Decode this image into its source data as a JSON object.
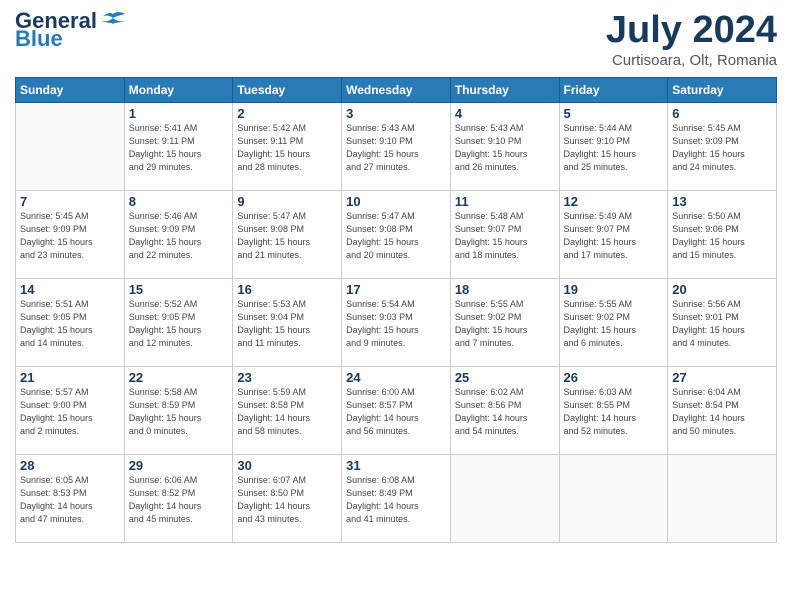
{
  "header": {
    "logo_line1": "General",
    "logo_line2": "Blue",
    "month": "July 2024",
    "location": "Curtisoara, Olt, Romania"
  },
  "days_of_week": [
    "Sunday",
    "Monday",
    "Tuesday",
    "Wednesday",
    "Thursday",
    "Friday",
    "Saturday"
  ],
  "weeks": [
    [
      {
        "day": "",
        "info": ""
      },
      {
        "day": "1",
        "info": "Sunrise: 5:41 AM\nSunset: 9:11 PM\nDaylight: 15 hours\nand 29 minutes."
      },
      {
        "day": "2",
        "info": "Sunrise: 5:42 AM\nSunset: 9:11 PM\nDaylight: 15 hours\nand 28 minutes."
      },
      {
        "day": "3",
        "info": "Sunrise: 5:43 AM\nSunset: 9:10 PM\nDaylight: 15 hours\nand 27 minutes."
      },
      {
        "day": "4",
        "info": "Sunrise: 5:43 AM\nSunset: 9:10 PM\nDaylight: 15 hours\nand 26 minutes."
      },
      {
        "day": "5",
        "info": "Sunrise: 5:44 AM\nSunset: 9:10 PM\nDaylight: 15 hours\nand 25 minutes."
      },
      {
        "day": "6",
        "info": "Sunrise: 5:45 AM\nSunset: 9:09 PM\nDaylight: 15 hours\nand 24 minutes."
      }
    ],
    [
      {
        "day": "7",
        "info": "Sunrise: 5:45 AM\nSunset: 9:09 PM\nDaylight: 15 hours\nand 23 minutes."
      },
      {
        "day": "8",
        "info": "Sunrise: 5:46 AM\nSunset: 9:09 PM\nDaylight: 15 hours\nand 22 minutes."
      },
      {
        "day": "9",
        "info": "Sunrise: 5:47 AM\nSunset: 9:08 PM\nDaylight: 15 hours\nand 21 minutes."
      },
      {
        "day": "10",
        "info": "Sunrise: 5:47 AM\nSunset: 9:08 PM\nDaylight: 15 hours\nand 20 minutes."
      },
      {
        "day": "11",
        "info": "Sunrise: 5:48 AM\nSunset: 9:07 PM\nDaylight: 15 hours\nand 18 minutes."
      },
      {
        "day": "12",
        "info": "Sunrise: 5:49 AM\nSunset: 9:07 PM\nDaylight: 15 hours\nand 17 minutes."
      },
      {
        "day": "13",
        "info": "Sunrise: 5:50 AM\nSunset: 9:06 PM\nDaylight: 15 hours\nand 15 minutes."
      }
    ],
    [
      {
        "day": "14",
        "info": "Sunrise: 5:51 AM\nSunset: 9:05 PM\nDaylight: 15 hours\nand 14 minutes."
      },
      {
        "day": "15",
        "info": "Sunrise: 5:52 AM\nSunset: 9:05 PM\nDaylight: 15 hours\nand 12 minutes."
      },
      {
        "day": "16",
        "info": "Sunrise: 5:53 AM\nSunset: 9:04 PM\nDaylight: 15 hours\nand 11 minutes."
      },
      {
        "day": "17",
        "info": "Sunrise: 5:54 AM\nSunset: 9:03 PM\nDaylight: 15 hours\nand 9 minutes."
      },
      {
        "day": "18",
        "info": "Sunrise: 5:55 AM\nSunset: 9:02 PM\nDaylight: 15 hours\nand 7 minutes."
      },
      {
        "day": "19",
        "info": "Sunrise: 5:55 AM\nSunset: 9:02 PM\nDaylight: 15 hours\nand 6 minutes."
      },
      {
        "day": "20",
        "info": "Sunrise: 5:56 AM\nSunset: 9:01 PM\nDaylight: 15 hours\nand 4 minutes."
      }
    ],
    [
      {
        "day": "21",
        "info": "Sunrise: 5:57 AM\nSunset: 9:00 PM\nDaylight: 15 hours\nand 2 minutes."
      },
      {
        "day": "22",
        "info": "Sunrise: 5:58 AM\nSunset: 8:59 PM\nDaylight: 15 hours\nand 0 minutes."
      },
      {
        "day": "23",
        "info": "Sunrise: 5:59 AM\nSunset: 8:58 PM\nDaylight: 14 hours\nand 58 minutes."
      },
      {
        "day": "24",
        "info": "Sunrise: 6:00 AM\nSunset: 8:57 PM\nDaylight: 14 hours\nand 56 minutes."
      },
      {
        "day": "25",
        "info": "Sunrise: 6:02 AM\nSunset: 8:56 PM\nDaylight: 14 hours\nand 54 minutes."
      },
      {
        "day": "26",
        "info": "Sunrise: 6:03 AM\nSunset: 8:55 PM\nDaylight: 14 hours\nand 52 minutes."
      },
      {
        "day": "27",
        "info": "Sunrise: 6:04 AM\nSunset: 8:54 PM\nDaylight: 14 hours\nand 50 minutes."
      }
    ],
    [
      {
        "day": "28",
        "info": "Sunrise: 6:05 AM\nSunset: 8:53 PM\nDaylight: 14 hours\nand 47 minutes."
      },
      {
        "day": "29",
        "info": "Sunrise: 6:06 AM\nSunset: 8:52 PM\nDaylight: 14 hours\nand 45 minutes."
      },
      {
        "day": "30",
        "info": "Sunrise: 6:07 AM\nSunset: 8:50 PM\nDaylight: 14 hours\nand 43 minutes."
      },
      {
        "day": "31",
        "info": "Sunrise: 6:08 AM\nSunset: 8:49 PM\nDaylight: 14 hours\nand 41 minutes."
      },
      {
        "day": "",
        "info": ""
      },
      {
        "day": "",
        "info": ""
      },
      {
        "day": "",
        "info": ""
      }
    ]
  ]
}
